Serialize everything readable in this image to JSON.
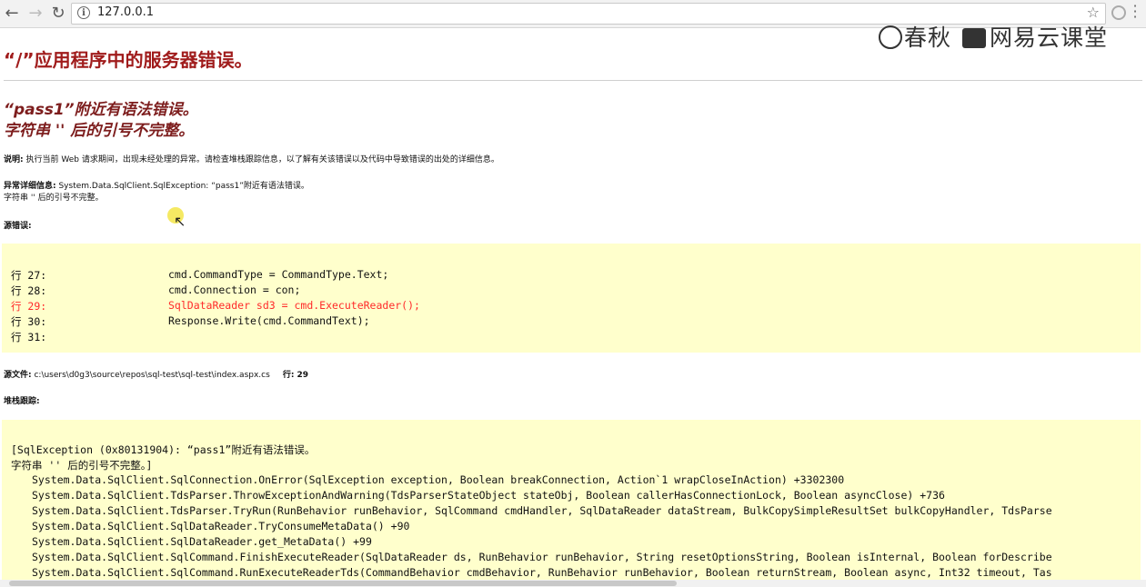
{
  "browser": {
    "url": "127.0.0.1",
    "back_icon": "arrow-left-icon",
    "forward_icon": "arrow-right-icon",
    "reload_icon": "reload-icon",
    "star_icon": "star-icon"
  },
  "watermark": {
    "text1": "春秋",
    "text2": "网易云课堂"
  },
  "page": {
    "title": "“/”应用程序中的服务器错误。",
    "error_line1": "“pass1”附近有语法错误。",
    "error_line2": "字符串 '' 后的引号不完整。",
    "desc_label": "说明:",
    "desc_text": " 执行当前 Web 请求期间，出现未经处理的异常。请检查堆栈跟踪信息，以了解有关该错误以及代码中导致错误的出处的详细信息。",
    "exc_label": "异常详细信息:",
    "exc_text": " System.Data.SqlClient.SqlException: “pass1”附近有语法错误。",
    "exc_text2": "字符串 '' 后的引号不完整。",
    "source_error_label": "源错误:",
    "source_file_label": "源文件:",
    "source_file_path": " c:\\users\\d0g3\\source\\repos\\sql-test\\sql-test\\index.aspx.cs",
    "source_file_line": "行: 29",
    "stack_label": "堆栈跟踪:"
  },
  "source_code": {
    "lines": [
      {
        "num": "行 27:",
        "code": "cmd.CommandType = CommandType.Text;"
      },
      {
        "num": "行 28:",
        "code": "cmd.Connection = con;"
      },
      {
        "num": "行 29:",
        "code": "SqlDataReader sd3 = cmd.ExecuteReader();"
      },
      {
        "num": "行 30:",
        "code": "Response.Write(cmd.CommandText);"
      },
      {
        "num": "行 31:",
        "code": ""
      }
    ]
  },
  "stack_trace": {
    "header1": "[SqlException (0x80131904): “pass1”附近有语法错误。",
    "header2": "字符串 '' 后的引号不完整。]",
    "lines": [
      "System.Data.SqlClient.SqlConnection.OnError(SqlException exception, Boolean breakConnection, Action`1 wrapCloseInAction) +3302300",
      "System.Data.SqlClient.TdsParser.ThrowExceptionAndWarning(TdsParserStateObject stateObj, Boolean callerHasConnectionLock, Boolean asyncClose) +736",
      "System.Data.SqlClient.TdsParser.TryRun(RunBehavior runBehavior, SqlCommand cmdHandler, SqlDataReader dataStream, BulkCopySimpleResultSet bulkCopyHandler, TdsParse",
      "System.Data.SqlClient.SqlDataReader.TryConsumeMetaData() +90",
      "System.Data.SqlClient.SqlDataReader.get_MetaData() +99",
      "System.Data.SqlClient.SqlCommand.FinishExecuteReader(SqlDataReader ds, RunBehavior runBehavior, String resetOptionsString, Boolean isInternal, Boolean forDescribe",
      "System.Data.SqlClient.SqlCommand.RunExecuteReaderTds(CommandBehavior cmdBehavior, RunBehavior runBehavior, Boolean returnStream, Boolean async, Int32 timeout, Tas"
    ]
  }
}
